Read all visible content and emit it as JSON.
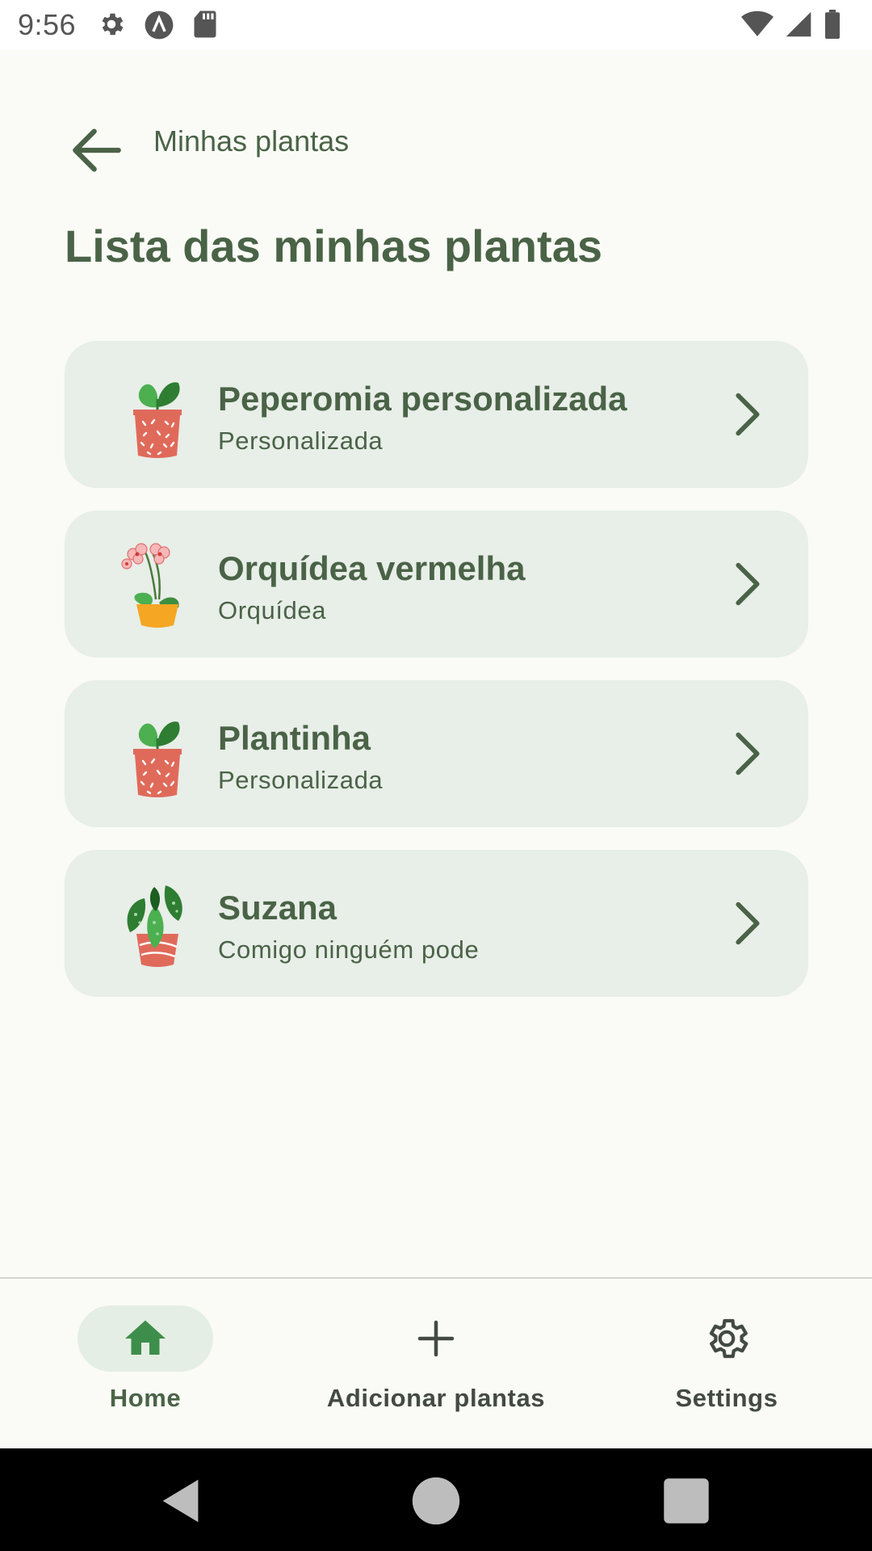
{
  "status_bar": {
    "time": "9:56",
    "left_icons": [
      "settings-icon",
      "a-icon",
      "sd-card-icon"
    ],
    "right_icons": [
      "wifi-icon",
      "signal-icon",
      "battery-icon"
    ]
  },
  "top_bar": {
    "back_icon": "arrow-back-icon",
    "title": "Minhas plantas"
  },
  "page": {
    "title": "Lista das minhas plantas"
  },
  "plants": [
    {
      "name": "Peperomia personalizada",
      "type": "Personalizada",
      "icon": "peperomia-plant-icon"
    },
    {
      "name": "Orquídea vermelha",
      "type": "Orquídea",
      "icon": "orchid-plant-icon"
    },
    {
      "name": "Plantinha",
      "type": "Personalizada",
      "icon": "peperomia-plant-icon"
    },
    {
      "name": "Suzana",
      "type": "Comigo ninguém pode",
      "icon": "dieffenbachia-plant-icon"
    }
  ],
  "bottom_nav": {
    "items": [
      {
        "label": "Home",
        "icon": "home-icon",
        "selected": true
      },
      {
        "label": "Adicionar plantas",
        "icon": "plus-icon",
        "selected": false
      },
      {
        "label": "Settings",
        "icon": "gear-icon",
        "selected": false
      }
    ]
  },
  "colors": {
    "background": "#FAFBF6",
    "card": "#E8EEE8",
    "text_primary": "#4A6347",
    "accent_green": "#3E8E4B",
    "pot_red": "#E06A5A",
    "pot_yellow": "#F5A623"
  }
}
